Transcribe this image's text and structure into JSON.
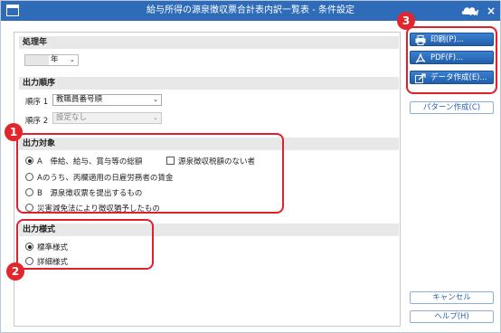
{
  "window": {
    "title": "給与所得の源泉徴収票合計表内訳一覧表 - 条件設定",
    "close_label": "×",
    "ai_label": "AI"
  },
  "year_section": {
    "header": "処理年",
    "year_unit": "年"
  },
  "order_section": {
    "header": "出力順序",
    "order1_label": "順序 1",
    "order1_value": "教職員番号順",
    "order2_label": "順序 2",
    "order2_value": "設定なし"
  },
  "target_section": {
    "header": "出力対象",
    "options": [
      "A　俸給、給与、賞与等の総額",
      "Aのうち、丙欄適用の日雇労務者の賃金",
      "B　源泉徴収票を提出するもの",
      "災害減免法により徴収猶予したもの"
    ],
    "checkbox_label": "源泉徴収税額のない者"
  },
  "format_section": {
    "header": "出力様式",
    "options": [
      "標準様式",
      "詳細様式"
    ]
  },
  "buttons": {
    "print": "印刷(P)...",
    "pdf": "PDF(F)...",
    "data": "データ作成(E)...",
    "pattern": "パターン作成(C)",
    "cancel": "キャンセル",
    "help": "ヘルプ(H)"
  },
  "badges": {
    "b1": "1",
    "b2": "2",
    "b3": "3"
  },
  "colors": {
    "titlebar": "#2e6bb8",
    "accent_button": "#2a6cc0",
    "highlight": "#e0202a"
  },
  "icons": {
    "print": "printer-icon",
    "pdf": "pdf-icon",
    "data": "export-icon",
    "window": "window-icon",
    "ai": "cloud-ai-icon"
  }
}
